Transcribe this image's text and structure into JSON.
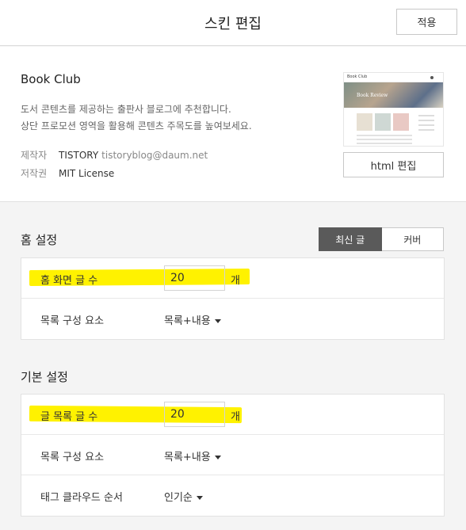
{
  "header": {
    "title": "스킨 편집",
    "apply_label": "적용"
  },
  "skin": {
    "name": "Book Club",
    "desc_line1": "도서 콘텐츠를 제공하는 출판사 블로그에 추천합니다.",
    "desc_line2": "상단 프로모션 영역을 활용해 콘텐츠 주목도를 높여보세요.",
    "author_label": "제작자",
    "author_name": "TISTORY",
    "author_email": "tistoryblog@daum.net",
    "license_label": "저작권",
    "license_value": "MIT License",
    "preview": {
      "logo": "Book Club",
      "hero_text": "Book Review"
    },
    "html_edit_label": "html 편집"
  },
  "home": {
    "title": "홈 설정",
    "tabs": [
      "최신 글",
      "커버"
    ],
    "active_tab": "최신 글",
    "rows": {
      "count_label": "홈 화면 글 수",
      "count_value": "20",
      "count_unit": "개",
      "list_label": "목록 구성 요소",
      "list_value": "목록+내용"
    }
  },
  "basic": {
    "title": "기본 설정",
    "rows": {
      "count_label": "글 목록 글 수",
      "count_value": "20",
      "count_unit": "개",
      "list_label": "목록 구성 요소",
      "list_value": "목록+내용",
      "tag_label": "태그 클라우드 순서",
      "tag_value": "인기순"
    }
  },
  "colors": {
    "highlight": "#fff200",
    "active_tab": "#5a5a5a"
  }
}
